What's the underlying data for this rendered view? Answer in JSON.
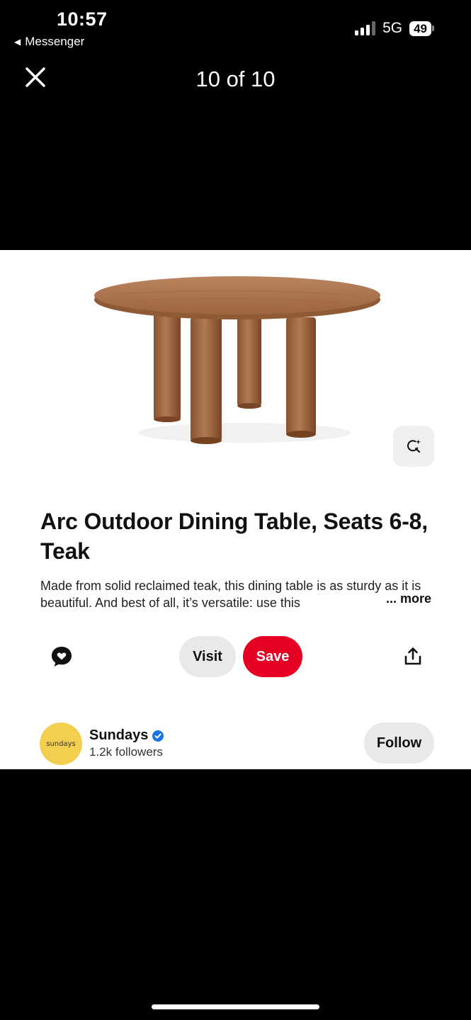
{
  "status_bar": {
    "time": "10:57",
    "back_app": "Messenger",
    "network": "5G",
    "battery": "49"
  },
  "viewer": {
    "counter": "10 of 10",
    "close_icon": "close-icon"
  },
  "pin": {
    "title": "Arc Outdoor Dining Table, Seats 6-8, Teak",
    "description": "Made from solid reclaimed teak, this dining table is as sturdy as it is beautiful. And best of all, it’s versatile: use this",
    "more_label": "... more",
    "actions": {
      "comment_icon": "comment-icon",
      "visit_label": "Visit",
      "save_label": "Save",
      "share_icon": "share-icon",
      "lens_icon": "visual-search-icon"
    },
    "colors": {
      "save": "#e60023",
      "secondary_button": "#e9e9e9",
      "avatar": "#f2cf4f",
      "verified": "#1a73e8"
    }
  },
  "creator": {
    "avatar_text": "sundays",
    "name": "Sundays",
    "followers": "1.2k followers",
    "follow_label": "Follow"
  }
}
